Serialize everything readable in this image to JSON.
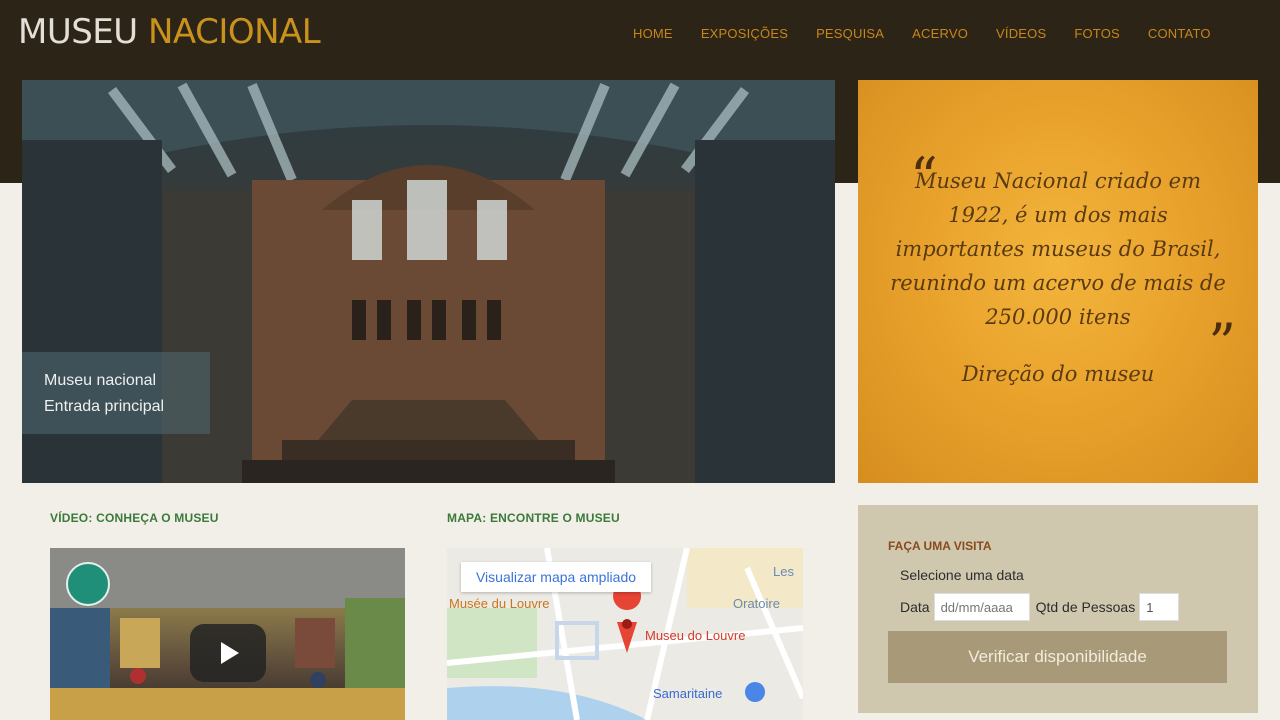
{
  "header": {
    "logo_part1": "MUSEU",
    "logo_part2": "NACIONAL",
    "nav": [
      "HOME",
      "EXPOSIÇÕES",
      "PESQUISA",
      "ACERVO",
      "VÍDEOS",
      "FOTOS",
      "CONTATO"
    ]
  },
  "hero": {
    "caption_line1": "Museu nacional",
    "caption_line2": "Entrada principal"
  },
  "quote": {
    "open_mark": "“",
    "close_mark": "”",
    "text": "Museu Nacional criado em 1922, é um dos mais importantes museus do Brasil, reunindo um acervo de mais de 250.000 itens",
    "author": "Direção do museu"
  },
  "video": {
    "title": "VÍDEO: CONHEÇA O MUSEU"
  },
  "map": {
    "title": "MAPA: ENCONTRE O MUSEU",
    "link": "Visualizar mapa ampliado",
    "pin_label": "Museu do Louvre",
    "place1": "Musée du Louvre",
    "place2": "Samaritaine",
    "place3": "Oratoire",
    "place4": "Les"
  },
  "visit": {
    "title": "FAÇA UMA VISITA",
    "select_text": "Selecione uma data",
    "date_label": "Data",
    "date_placeholder": "dd/mm/aaaa",
    "qty_label": "Qtd de Pessoas",
    "qty_value": "1",
    "button": "Verificar disponibilidade"
  },
  "colors": {
    "header_bg": "#2b2417",
    "accent": "#c8861a",
    "section_title": "#3a7a3a",
    "quote_bg": "#e9a32c",
    "visit_bg": "#cfc8ae"
  }
}
